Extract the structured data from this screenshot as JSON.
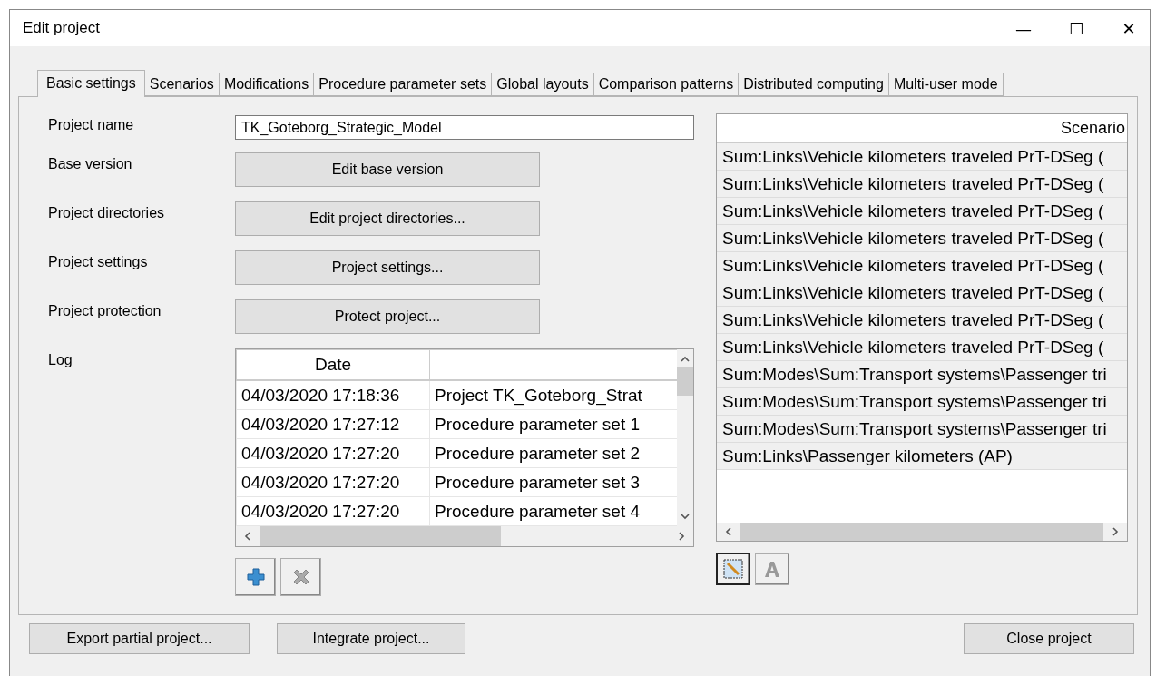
{
  "window": {
    "title": "Edit project",
    "controls": [
      "—",
      "☐",
      "✕"
    ]
  },
  "tabs": [
    {
      "label": "Basic settings",
      "selected": true
    },
    {
      "label": "Scenarios",
      "selected": false
    },
    {
      "label": "Modifications",
      "selected": false
    },
    {
      "label": "Procedure parameter sets",
      "selected": false
    },
    {
      "label": "Global layouts",
      "selected": false
    },
    {
      "label": "Comparison patterns",
      "selected": false
    },
    {
      "label": "Distributed computing",
      "selected": false
    },
    {
      "label": "Multi-user mode",
      "selected": false
    }
  ],
  "form": {
    "fields": [
      {
        "kind": "input",
        "label": "Project name",
        "value": "TK_Goteborg_Strategic_Model"
      },
      {
        "kind": "button",
        "label": "Base version",
        "button": "Edit base version"
      },
      {
        "kind": "button",
        "label": "Project directories",
        "button": "Edit project directories..."
      },
      {
        "kind": "button",
        "label": "Project settings",
        "button": "Project settings..."
      },
      {
        "kind": "button",
        "label": "Project protection",
        "button": "Protect project..."
      }
    ]
  },
  "log": {
    "label": "Log",
    "columns": [
      "Date",
      ""
    ],
    "rows": [
      [
        "04/03/2020 17:18:36",
        "Project TK_Goteborg_Strat"
      ],
      [
        "04/03/2020 17:27:12",
        "Procedure parameter set 1"
      ],
      [
        "04/03/2020 17:27:20",
        "Procedure parameter set 2"
      ],
      [
        "04/03/2020 17:27:20",
        "Procedure parameter set 3"
      ],
      [
        "04/03/2020 17:27:20",
        "Procedure parameter set 4"
      ]
    ]
  },
  "scenario_list": {
    "header": "Scenario",
    "rows": [
      "Sum:Links\\Vehicle kilometers traveled PrT-DSeg (",
      "Sum:Links\\Vehicle kilometers traveled PrT-DSeg (",
      "Sum:Links\\Vehicle kilometers traveled PrT-DSeg (",
      "Sum:Links\\Vehicle kilometers traveled PrT-DSeg (",
      "Sum:Links\\Vehicle kilometers traveled PrT-DSeg (",
      "Sum:Links\\Vehicle kilometers traveled PrT-DSeg (",
      "Sum:Links\\Vehicle kilometers traveled PrT-DSeg (",
      "Sum:Links\\Vehicle kilometers traveled PrT-DSeg (",
      "Sum:Modes\\Sum:Transport systems\\Passenger tri",
      "Sum:Modes\\Sum:Transport systems\\Passenger tri",
      "Sum:Modes\\Sum:Transport systems\\Passenger tri",
      "Sum:Links\\Passenger kilometers (AP)"
    ]
  },
  "footer": {
    "left": [
      "Export partial project...",
      "Integrate project..."
    ],
    "right": "Close project"
  }
}
